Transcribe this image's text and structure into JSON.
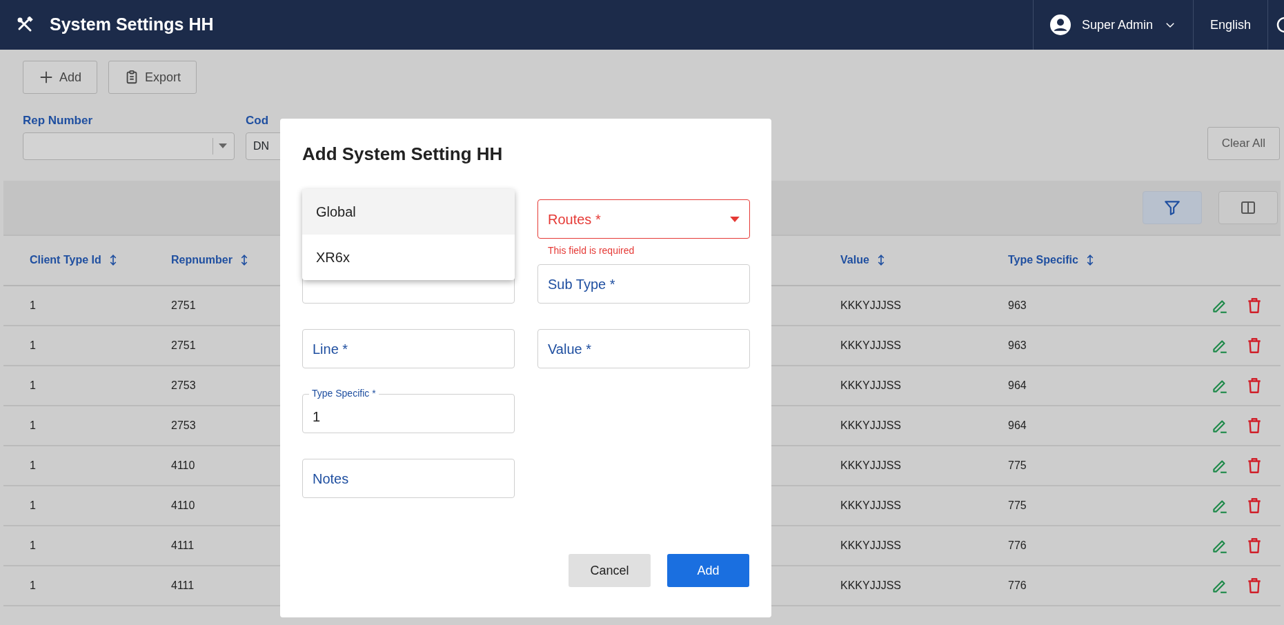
{
  "header": {
    "title": "System Settings HH",
    "user": "Super Admin",
    "language": "English"
  },
  "toolbar": {
    "buttons": [
      {
        "label": "Add"
      },
      {
        "label": "Export"
      }
    ]
  },
  "filters": [
    {
      "label": "Rep Number",
      "kind": "select"
    },
    {
      "label": "Cod",
      "kind": "text",
      "value": "DN"
    }
  ],
  "clear_all": "Clear All",
  "table_tools": {
    "filter_active": true
  },
  "table": {
    "columns": [
      "Client Type Id",
      "Repnumber",
      "Value",
      "Type Specific"
    ],
    "rows": [
      [
        "1",
        "2751",
        "KKKYJJJSS",
        "963"
      ],
      [
        "1",
        "2751",
        "KKKYJJJSS",
        "963"
      ],
      [
        "1",
        "2753",
        "KKKYJJJSS",
        "964"
      ],
      [
        "1",
        "2753",
        "KKKYJJJSS",
        "964"
      ],
      [
        "1",
        "4110",
        "KKKYJJJSS",
        "775"
      ],
      [
        "1",
        "4110",
        "KKKYJJJSS",
        "775"
      ],
      [
        "1",
        "4111",
        "KKKYJJJSS",
        "776"
      ],
      [
        "1",
        "4111",
        "KKKYJJJSS",
        "776"
      ]
    ]
  },
  "dialog": {
    "title": "Add System Setting HH",
    "rows": [
      {
        "fields": [
          {
            "kind": "covered"
          },
          {
            "kind": "select",
            "label": "Routes *",
            "error": "This field is required"
          }
        ]
      },
      {
        "fields": [
          {
            "kind": "covered"
          },
          {
            "kind": "text",
            "label": "Sub Type *"
          }
        ]
      },
      {
        "fields": [
          {
            "kind": "text",
            "label": "Line *"
          },
          {
            "kind": "text",
            "label": "Value *"
          }
        ]
      },
      {
        "fields": [
          {
            "kind": "text",
            "label": "Type Specific *",
            "value": "1"
          }
        ]
      },
      {
        "fields": [
          {
            "kind": "text",
            "label": "Notes"
          }
        ]
      }
    ],
    "menu": [
      {
        "label": "Global",
        "selected": true
      },
      {
        "label": "XR6x",
        "selected": false
      }
    ],
    "buttons": [
      {
        "label": "Cancel",
        "kind": "secondary"
      },
      {
        "label": "Add",
        "kind": "primary"
      }
    ]
  }
}
